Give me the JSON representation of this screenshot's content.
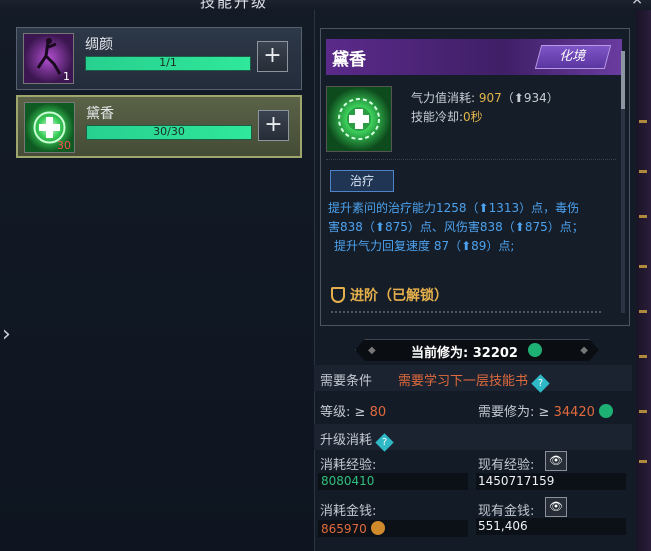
{
  "window": {
    "title": "技能升级",
    "close": "×"
  },
  "skills": [
    {
      "name": "绸颜",
      "level": "1",
      "progress": "1/1",
      "add": "+"
    },
    {
      "name": "黛香",
      "level": "30",
      "progress": "30/30",
      "add": "+"
    }
  ],
  "nav": {
    "expand": "›"
  },
  "detail": {
    "name": "黛香",
    "badge": "化境",
    "qi_cost_label": "气力值消耗:",
    "qi_cost": "907",
    "qi_cost_next": "（⬆934）",
    "cooldown_label": "技能冷却:",
    "cooldown": "0秒",
    "tag": "治疗",
    "desc_line1": "提升素问的治疗能力1258（⬆1313）点，毒伤",
    "desc_line2": "害838（⬆875）点、风伤害838（⬆875）点；",
    "desc_line3": "提升气力回复速度 87（⬆89）点;",
    "advanced": "进阶（已解锁）"
  },
  "power": {
    "label": "当前修为:",
    "value": "32202"
  },
  "requirements": {
    "title": "需要条件",
    "need_book": "需要学习下一层技能书",
    "level_label": "等级:",
    "level_op": "≥",
    "level_value": "80",
    "cult_label": "需要修为:",
    "cult_op": "≥",
    "cult_value": "34420"
  },
  "cost": {
    "title": "升级消耗",
    "exp_label": "消耗经验:",
    "exp_value": "8080410",
    "cur_exp_label": "现有经验:",
    "cur_exp_value": "1450717159",
    "money_label": "消耗金钱:",
    "money_value": "865970",
    "cur_money_label": "现有金钱:",
    "cur_money_value": "551,406"
  },
  "help_glyph": "?",
  "eye_glyph": "👁",
  "colors": {
    "accent_green": "#2fe89a",
    "purple": "#5b2a8a",
    "red": "#e06a3d",
    "gold": "#e5b04c"
  }
}
